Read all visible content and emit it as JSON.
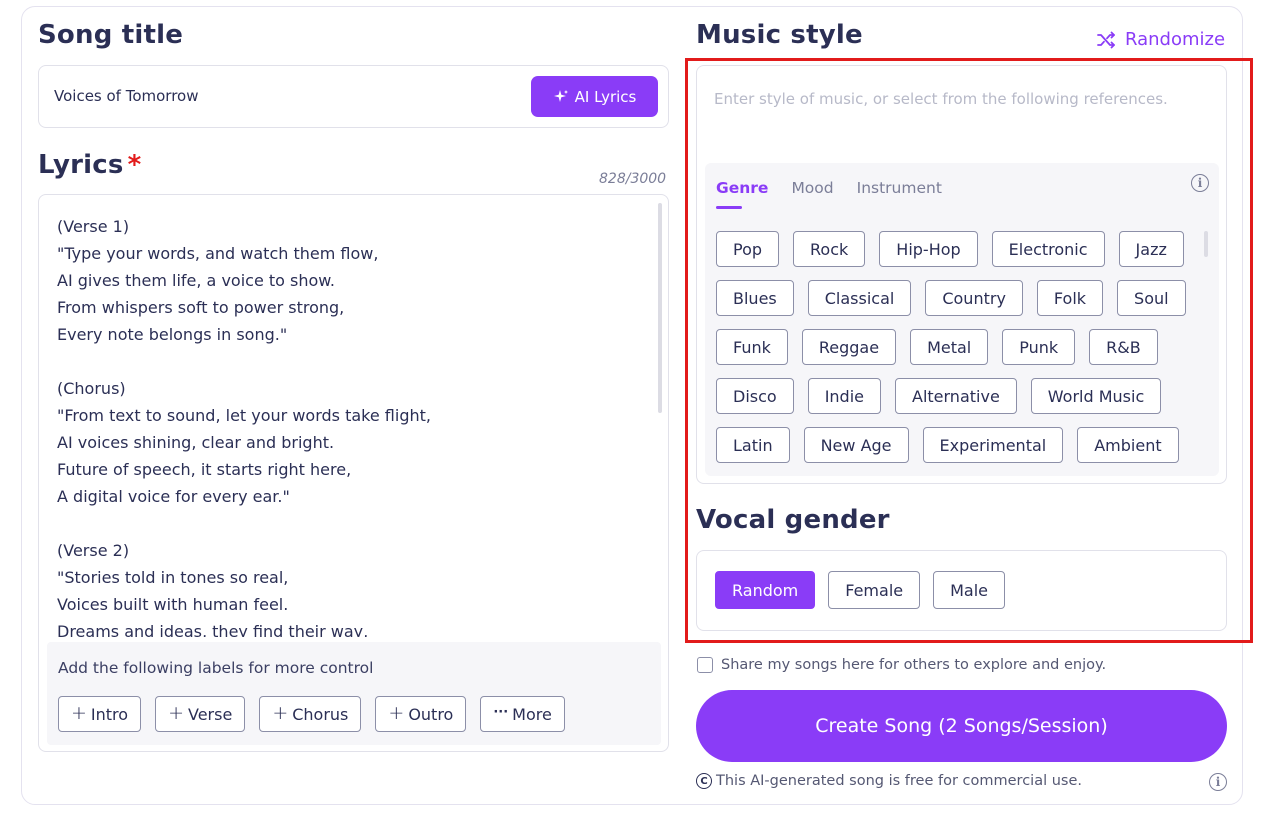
{
  "song_title": {
    "heading": "Song title",
    "value": "Voices of Tomorrow",
    "ai_button": "AI Lyrics"
  },
  "lyrics": {
    "heading": "Lyrics",
    "required_mark": "*",
    "counter": "828/3000",
    "text": "(Verse 1)\n\"Type your words, and watch them flow,\nAI gives them life, a voice to show.\nFrom whispers soft to power strong,\nEvery note belongs in song.\"\n\n(Chorus)\n\"From text to sound, let your words take flight,\nAI voices shining, clear and bright.\nFuture of speech, it starts right here,\nA digital voice for every ear.\"\n\n(Verse 2)\n\"Stories told in tones so real,\nVoices built with human feel.\nDreams and ideas, they find their way,",
    "labels_title": "Add the following labels for more control",
    "labels": [
      "Intro",
      "Verse",
      "Chorus",
      "Outro",
      "More"
    ]
  },
  "music_style": {
    "heading": "Music style",
    "randomize": "Randomize",
    "placeholder": "Enter style of music, or select from the following references.",
    "tabs": [
      "Genre",
      "Mood",
      "Instrument"
    ],
    "active_tab": "Genre",
    "genres": [
      [
        "Pop",
        "Rock",
        "Hip-Hop",
        "Electronic",
        "Jazz"
      ],
      [
        "Blues",
        "Classical",
        "Country",
        "Folk",
        "Soul"
      ],
      [
        "Funk",
        "Reggae",
        "Metal",
        "Punk",
        "R&B"
      ],
      [
        "Disco",
        "Indie",
        "Alternative",
        "World Music"
      ],
      [
        "Latin",
        "New Age",
        "Experimental",
        "Ambient"
      ]
    ]
  },
  "vocal_gender": {
    "heading": "Vocal gender",
    "options": [
      "Random",
      "Female",
      "Male"
    ],
    "selected": "Random"
  },
  "share_text": "Share my songs here for others to explore and enjoy.",
  "create_button": "Create Song (2 Songs/Session)",
  "footer_note": "This AI-generated song is free for commercial use.",
  "colors": {
    "accent": "#8a3cf7",
    "heading": "#2b2f55",
    "highlight": "#e21b1b"
  }
}
